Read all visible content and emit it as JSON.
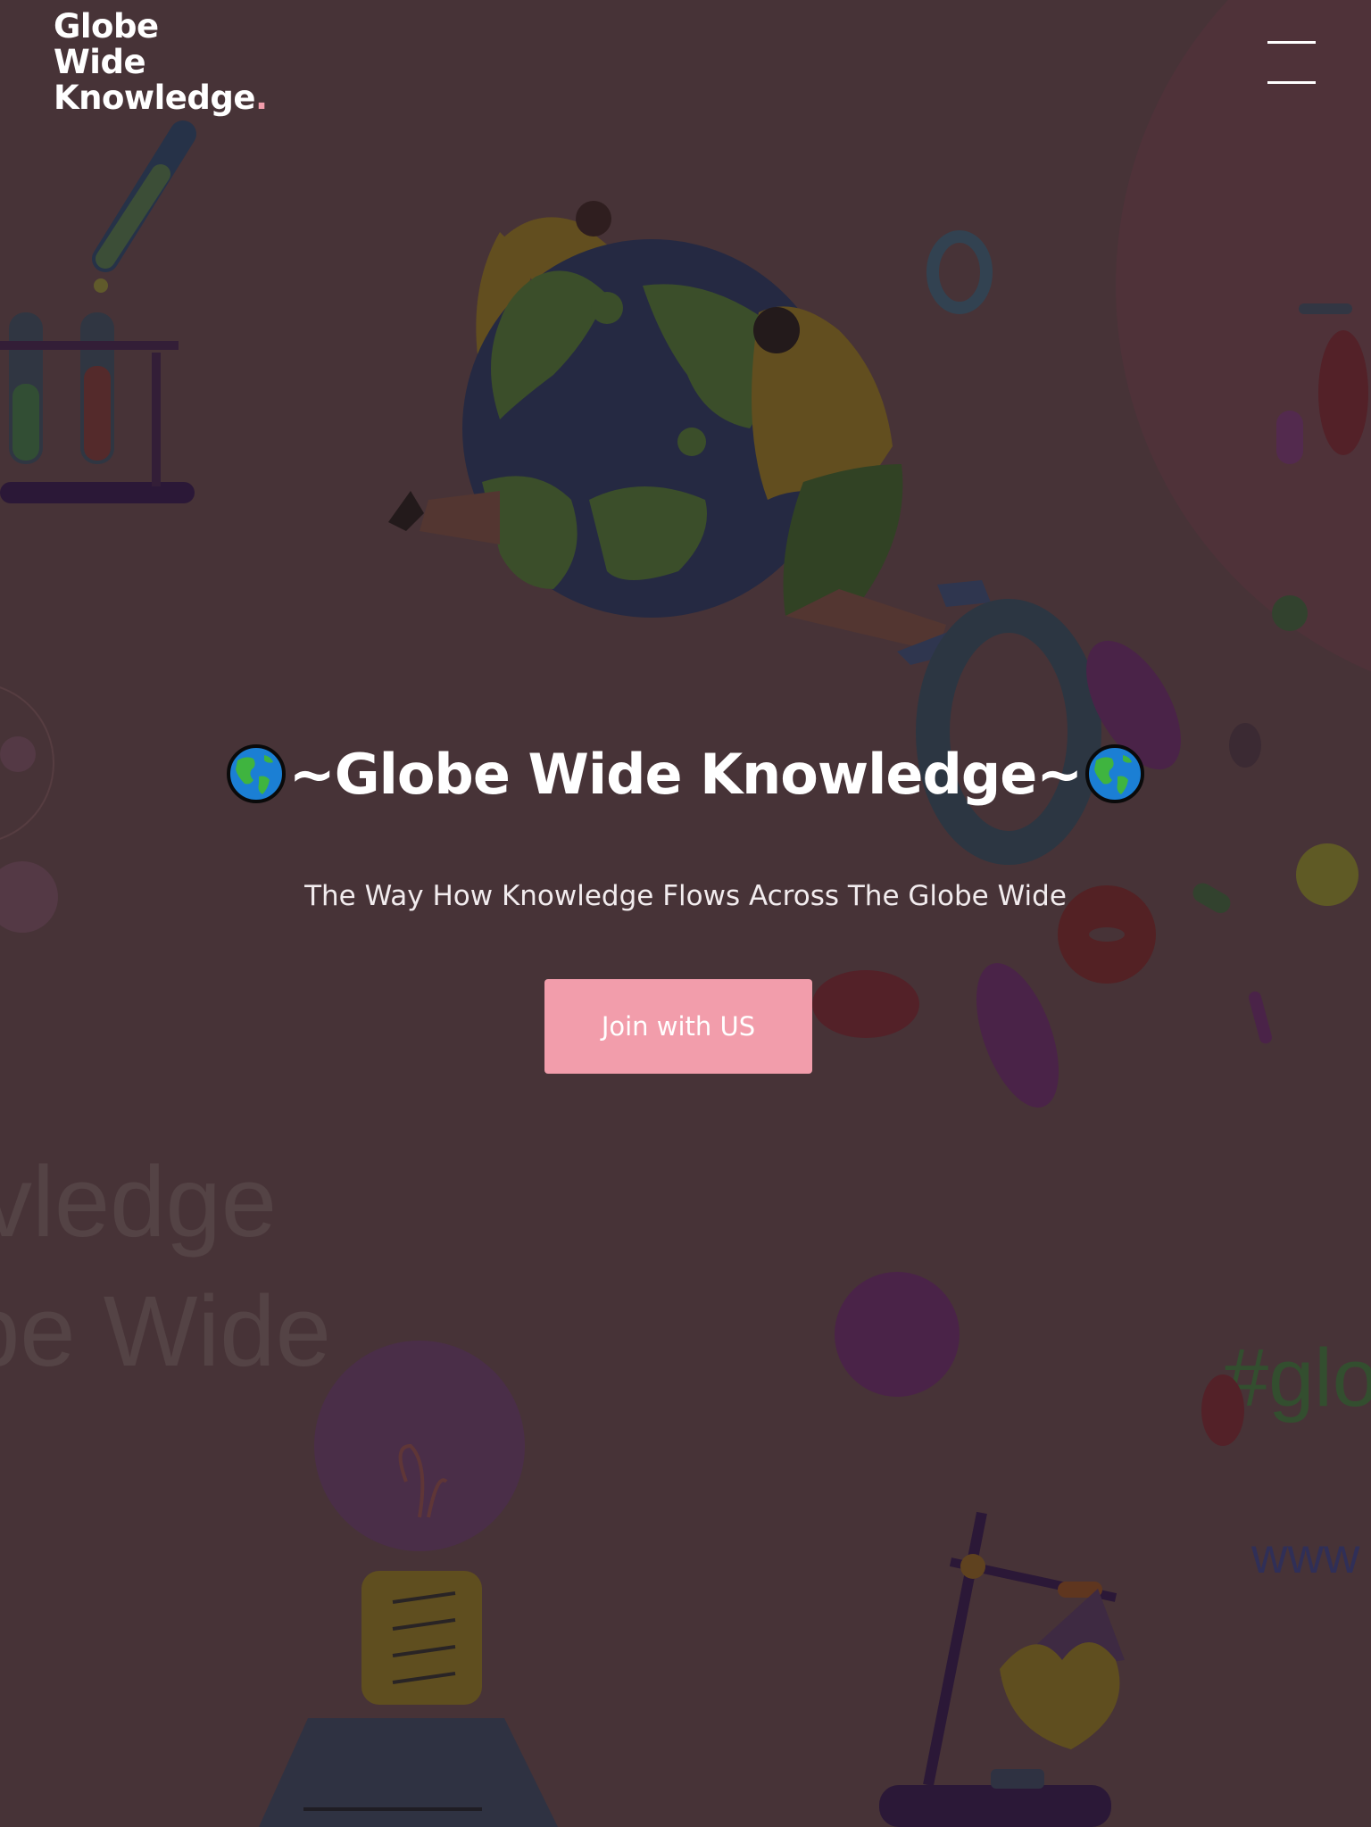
{
  "header": {
    "logo_lines": [
      "Globe",
      "Wide",
      "Knowledge"
    ],
    "logo_dot": "."
  },
  "menu": {
    "icon": "hamburger-menu-icon"
  },
  "hero": {
    "title": "~Globe Wide Knowledge~",
    "title_icon": "earth-globe-americas-icon",
    "subtitle": "The Way How Knowledge Flows Across The Globe Wide",
    "cta_label": "Join with US"
  },
  "background": {
    "text_line_1": "vledge",
    "text_line_2": "be Wide",
    "hashtag": "#glo",
    "www": "www"
  },
  "colors": {
    "background": "#4a363a",
    "accent": "#f29dab",
    "text": "#ffffff"
  }
}
